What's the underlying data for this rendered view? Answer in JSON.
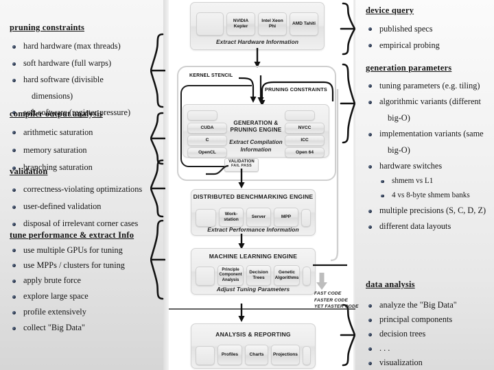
{
  "left_column": [
    {
      "heading": "pruning constraints",
      "items": [
        {
          "text": "hard hardware (max threads)",
          "type": "bullet"
        },
        {
          "text": "soft hardware (full warps)",
          "type": "bullet"
        },
        {
          "text": "hard software (divisible",
          "type": "bullet"
        },
        {
          "text": "dimensions)",
          "type": "cont"
        },
        {
          "text": "soft software (register pressure)",
          "type": "bullet"
        }
      ]
    },
    {
      "heading": "compiler output analysis",
      "items": [
        {
          "text": "arithmetic saturation",
          "type": "bullet"
        },
        {
          "text": "memory saturation",
          "type": "bullet"
        },
        {
          "text": "branching saturation",
          "type": "bullet"
        }
      ]
    },
    {
      "heading": "validation",
      "items": [
        {
          "text": "correctness-violating optimizations",
          "type": "bullet"
        },
        {
          "text": "user-defined validation",
          "type": "bullet"
        },
        {
          "text": "disposal of irrelevant corner cases",
          "type": "bullet"
        }
      ]
    },
    {
      "heading": "tune performance & extract Info",
      "items": [
        {
          "text": "use multiple GPUs for tuning",
          "type": "bullet"
        },
        {
          "text": "use MPPs / clusters for tuning",
          "type": "bullet"
        },
        {
          "text": "apply brute force",
          "type": "bullet"
        },
        {
          "text": "explore large space",
          "type": "bullet"
        },
        {
          "text": "profile extensively",
          "type": "bullet"
        },
        {
          "text": "collect \"Big Data\"",
          "type": "bullet"
        }
      ]
    }
  ],
  "right_column": [
    {
      "heading": "device query",
      "items": [
        {
          "text": "published specs",
          "type": "bullet"
        },
        {
          "text": "empirical probing",
          "type": "bullet"
        }
      ]
    },
    {
      "heading": "generation parameters",
      "items": [
        {
          "text": "tuning parameters (e.g. tiling)",
          "type": "bullet"
        },
        {
          "text": "algorithmic variants (different",
          "type": "bullet"
        },
        {
          "text": "big-O)",
          "type": "cont"
        },
        {
          "text": "implementation variants (same",
          "type": "bullet"
        },
        {
          "text": "big-O)",
          "type": "cont"
        },
        {
          "text": "hardware switches",
          "type": "bullet"
        },
        {
          "text": "shmem vs L1",
          "type": "sub"
        },
        {
          "text": "4 vs 8-byte shmem banks",
          "type": "sub"
        },
        {
          "text": "multiple precisions (S, C, D, Z)",
          "type": "bullet"
        },
        {
          "text": "different data layouts",
          "type": "bullet"
        }
      ]
    },
    {
      "heading": "data analysis",
      "items": [
        {
          "text": "analyze the \"Big Data\"",
          "type": "bullet"
        },
        {
          "text": "principal components",
          "type": "bullet"
        },
        {
          "text": "decision trees",
          "type": "bullet"
        },
        {
          "text": ". . .",
          "type": "bullet"
        },
        {
          "text": "visualization",
          "type": "bullet"
        }
      ]
    }
  ],
  "diagram": {
    "hardware_box": {
      "chips": [
        "NVIDIA Kepler",
        "Intel Xeon Phi",
        "AMD Tahiti"
      ],
      "caption": "Extract Hardware Information"
    },
    "kernel_stencil_label": "KERNEL STENCIL",
    "pruning_constraints_label": "PRUNING CONSTRAINTS",
    "engine_box": {
      "title": "GENERATION & PRUNING ENGINE",
      "caption": "Extract Compilation Information",
      "left_chips": [
        "CUDA",
        "C",
        "OpenCL"
      ],
      "right_chips": [
        "NVCC",
        "ICC",
        "Open 64"
      ]
    },
    "validation": {
      "line1": "VALIDATION",
      "line2": "FAIL  PASS"
    },
    "benchmark_box": {
      "title": "DISTRIBUTED BENCHMARKING ENGINE",
      "chips": [
        "Work-station",
        "Server",
        "MPP"
      ],
      "caption": "Extract Performance Information"
    },
    "ml_box": {
      "title": "MACHINE LEARNING ENGINE",
      "chips": [
        "Principle Component Analysis",
        "Decision Trees",
        "Genetic Algorithms"
      ],
      "caption": "Adjust Tuning Parameters"
    },
    "fast_code": [
      "FAST CODE",
      "FASTER CODE",
      "YET FASTER CODE"
    ],
    "report_box": {
      "title": "ANALYSIS & REPORTING",
      "chips": [
        "Profiles",
        "Charts",
        "Projections"
      ]
    }
  }
}
